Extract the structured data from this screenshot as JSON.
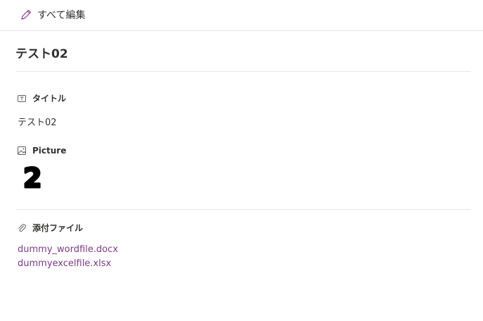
{
  "toolbar": {
    "edit_all_label": "すべて編集"
  },
  "item": {
    "title": "テスト02"
  },
  "fields": {
    "title_field": {
      "label": "タイトル",
      "value": "テスト02"
    },
    "picture_field": {
      "label": "Picture",
      "image_text": "2"
    },
    "attachments_field": {
      "label": "添付ファイル",
      "files": [
        "dummy_wordfile.docx",
        "dummyexcelfile.xlsx"
      ]
    }
  },
  "colors": {
    "link": "#7c3a86",
    "accent_pencil": "#8a3d8f",
    "divider": "#e8e6e4"
  },
  "icons": {
    "edit": "pencil-icon",
    "title_field": "text-field-icon",
    "picture_field": "image-icon",
    "attachments_field": "paperclip-icon"
  }
}
